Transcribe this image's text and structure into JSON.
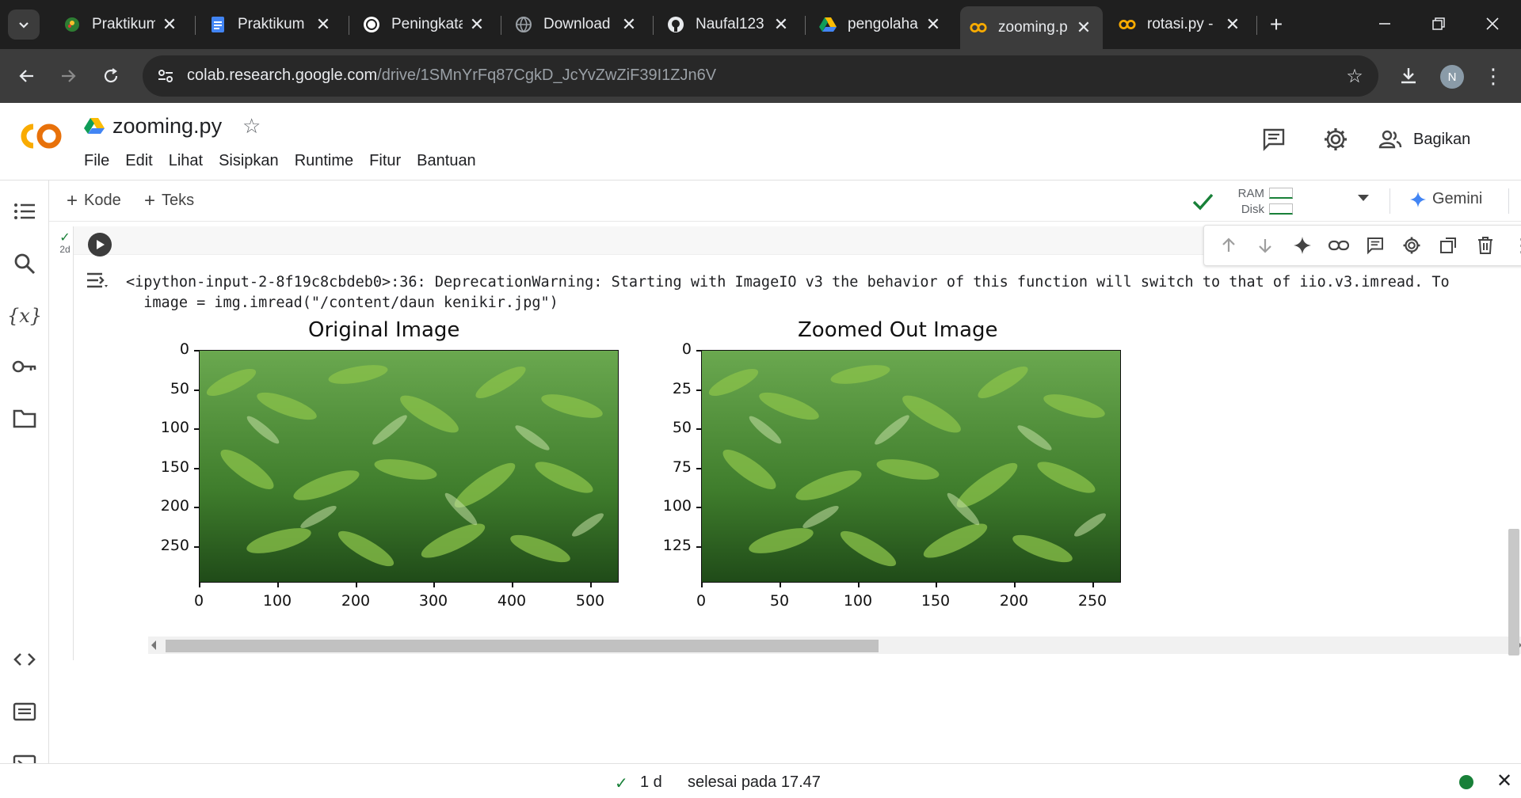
{
  "browser": {
    "tabs": [
      {
        "title": "Praktikum",
        "icon": "spreadsheet-favicon",
        "active": false
      },
      {
        "title": "Praktikum",
        "icon": "google-docs-favicon",
        "active": false
      },
      {
        "title": "Peningkata",
        "icon": "chatgpt-favicon",
        "active": false
      },
      {
        "title": "Download",
        "icon": "globe-favicon",
        "active": false
      },
      {
        "title": "Naufal123",
        "icon": "github-favicon",
        "active": false
      },
      {
        "title": "pengolaha",
        "icon": "google-drive-favicon",
        "active": false
      },
      {
        "title": "zooming.p",
        "icon": "colab-favicon",
        "active": true
      },
      {
        "title": "rotasi.py -",
        "icon": "colab-favicon",
        "active": false
      }
    ],
    "url_host": "colab.research.google.com",
    "url_path": "/drive/1SMnYrFq87CgkD_JcYvZwZiF39I1ZJn6V",
    "profile_initial": "N"
  },
  "colab": {
    "doc_title": "zooming.py",
    "menu": [
      "File",
      "Edit",
      "Lihat",
      "Sisipkan",
      "Runtime",
      "Fitur",
      "Bantuan"
    ],
    "share_label": "Bagikan",
    "toolbar": {
      "add_code": "Kode",
      "add_text": "Teks",
      "ram_label": "RAM",
      "disk_label": "Disk",
      "gemini_label": "Gemini"
    },
    "cell": {
      "exec_time": "2d",
      "warning_line1": "<ipython-input-2-8f19c8cbdeb0>:36: DeprecationWarning: Starting with ImageIO v3 the behavior of this function will switch to that of iio.v3.imread. To",
      "warning_line2": "  image = img.imread(\"/content/daun kenikir.jpg\")"
    },
    "status": {
      "exec_time": "1 d",
      "message": "selesai pada 17.47"
    },
    "accent": "#f9ab00",
    "ok_color": "#188038"
  },
  "plots": [
    {
      "title": "Original Image",
      "y_ticks": [
        "0",
        "50",
        "100",
        "150",
        "200",
        "250"
      ],
      "x_ticks": [
        "0",
        "100",
        "200",
        "300",
        "400",
        "500"
      ]
    },
    {
      "title": "Zoomed Out Image",
      "y_ticks": [
        "0",
        "25",
        "50",
        "75",
        "100",
        "125"
      ],
      "x_ticks": [
        "0",
        "50",
        "100",
        "150",
        "200",
        "250"
      ]
    }
  ]
}
